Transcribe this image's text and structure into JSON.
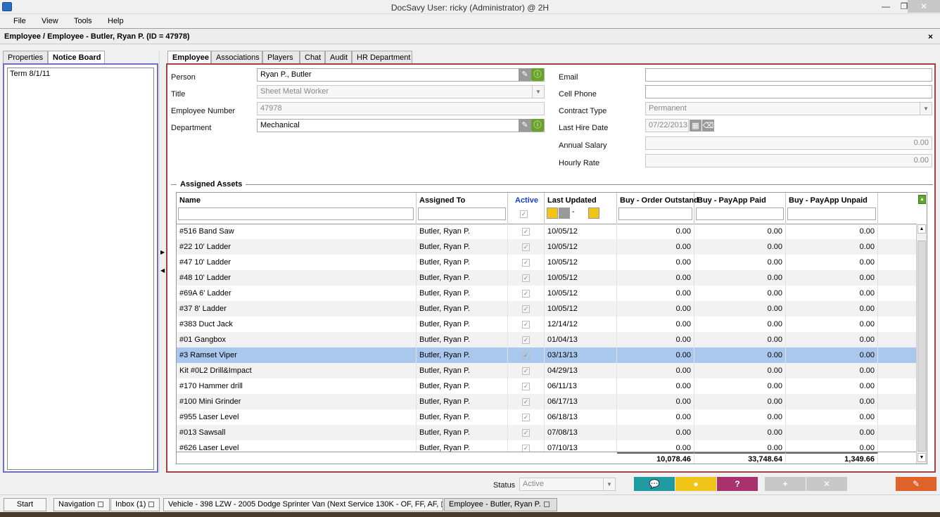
{
  "window": {
    "title": "DocSavy   User: ricky (Administrator) @ 2H",
    "minimize": "—",
    "maximize": "❐",
    "close": "✕"
  },
  "menu": [
    "File",
    "View",
    "Tools",
    "Help"
  ],
  "doc": {
    "breadcrumb": "Employee / Employee - Butler, Ryan P.  (ID = 47978)",
    "close": "×"
  },
  "left": {
    "tabs": [
      "Properties",
      "Notice Board"
    ],
    "notice": "Term 8/1/11"
  },
  "tabs": [
    "Employee",
    "Associations",
    "Players",
    "Chat",
    "Audit",
    "HR Department"
  ],
  "form": {
    "person_label": "Person",
    "person": "Ryan P., Butler",
    "title_label": "Title",
    "title": "Sheet Metal Worker",
    "empnum_label": "Employee Number",
    "empnum": "47978",
    "dept_label": "Department",
    "dept": "Mechanical",
    "email_label": "Email",
    "email": "",
    "cell_label": "Cell Phone",
    "cell": "",
    "contract_label": "Contract Type",
    "contract": "Permanent",
    "hire_label": "Last Hire Date",
    "hire": "07/22/2013",
    "salary_label": "Annual Salary",
    "salary": "0.00",
    "hourly_label": "Hourly Rate",
    "hourly": "0.00"
  },
  "assets": {
    "legend": "Assigned Assets",
    "columns": [
      "Name",
      "Assigned To",
      "Active",
      "Last Updated",
      "Buy - Order Outstand",
      "Buy - PayApp Paid",
      "Buy - PayApp Unpaid"
    ],
    "active_color": "#1a3ccf",
    "selected_row": 8,
    "rows": [
      [
        "#516 Band Saw",
        "Butler, Ryan P.",
        "10/05/12",
        "0.00",
        "0.00",
        "0.00"
      ],
      [
        "#22 10' Ladder",
        "Butler, Ryan P.",
        "10/05/12",
        "0.00",
        "0.00",
        "0.00"
      ],
      [
        "#47 10' Ladder",
        "Butler, Ryan P.",
        "10/05/12",
        "0.00",
        "0.00",
        "0.00"
      ],
      [
        "#48 10' Ladder",
        "Butler, Ryan P.",
        "10/05/12",
        "0.00",
        "0.00",
        "0.00"
      ],
      [
        "#69A 6' Ladder",
        "Butler, Ryan P.",
        "10/05/12",
        "0.00",
        "0.00",
        "0.00"
      ],
      [
        "#37 8' Ladder",
        "Butler, Ryan P.",
        "10/05/12",
        "0.00",
        "0.00",
        "0.00"
      ],
      [
        "#383 Duct Jack",
        "Butler, Ryan P.",
        "12/14/12",
        "0.00",
        "0.00",
        "0.00"
      ],
      [
        "#01 Gangbox",
        "Butler, Ryan P.",
        "01/04/13",
        "0.00",
        "0.00",
        "0.00"
      ],
      [
        "#3 Ramset Viper",
        "Butler, Ryan P.",
        "03/13/13",
        "0.00",
        "0.00",
        "0.00"
      ],
      [
        "Kit #0L2 Drill&Impact",
        "Butler, Ryan P.",
        "04/29/13",
        "0.00",
        "0.00",
        "0.00"
      ],
      [
        "#170 Hammer drill",
        "Butler, Ryan P.",
        "06/11/13",
        "0.00",
        "0.00",
        "0.00"
      ],
      [
        "#100 Mini Grinder",
        "Butler, Ryan P.",
        "06/17/13",
        "0.00",
        "0.00",
        "0.00"
      ],
      [
        "#955 Laser Level",
        "Butler, Ryan P.",
        "06/18/13",
        "0.00",
        "0.00",
        "0.00"
      ],
      [
        "#013 Sawsall",
        "Butler, Ryan P.",
        "07/08/13",
        "0.00",
        "0.00",
        "0.00"
      ],
      [
        "#626 Laser Level",
        "Butler, Ryan P.",
        "07/10/13",
        "0.00",
        "0.00",
        "0.00"
      ]
    ],
    "totals": [
      "10,078.46",
      "33,748.64",
      "1,349.66"
    ]
  },
  "status": {
    "label": "Status",
    "value": "Active"
  },
  "actions": {
    "colors": [
      "#1f9aa0",
      "#f0c419",
      "#a8326e",
      "#c8c8c8",
      "#c8c8c8",
      "#e0612a"
    ]
  },
  "taskbar": [
    "Start",
    "Navigation",
    "Inbox (1)",
    "Vehicle - 398 LZW - 2005 Dodge Sprinter Van (Next Service 130K -  OF, FF, AF,",
    "Employee - Butler, Ryan P."
  ]
}
